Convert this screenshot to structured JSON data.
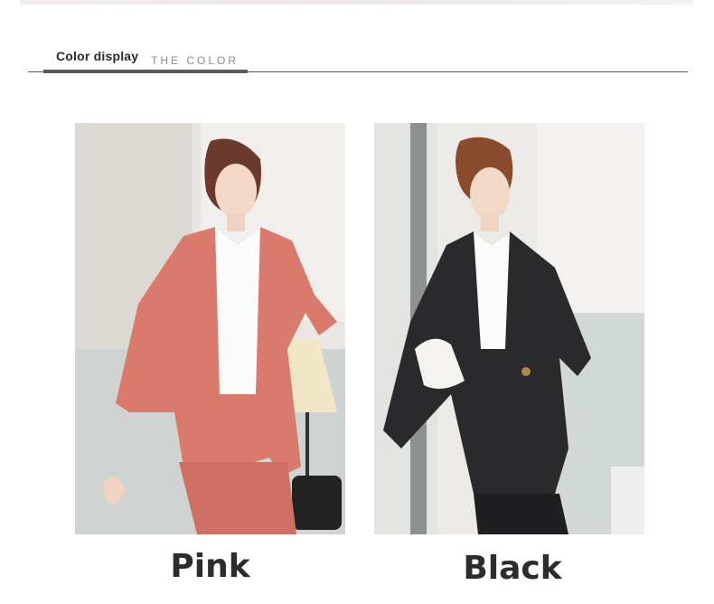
{
  "header": {
    "title": "Color display",
    "subtitle": "THE COLOR"
  },
  "products": [
    {
      "color_name": "Pink",
      "image_alt": "Model wearing pink suit",
      "suit_color": "#d97a6c"
    },
    {
      "color_name": "Black",
      "image_alt": "Model wearing black suit",
      "suit_color": "#2a2a2d"
    }
  ]
}
